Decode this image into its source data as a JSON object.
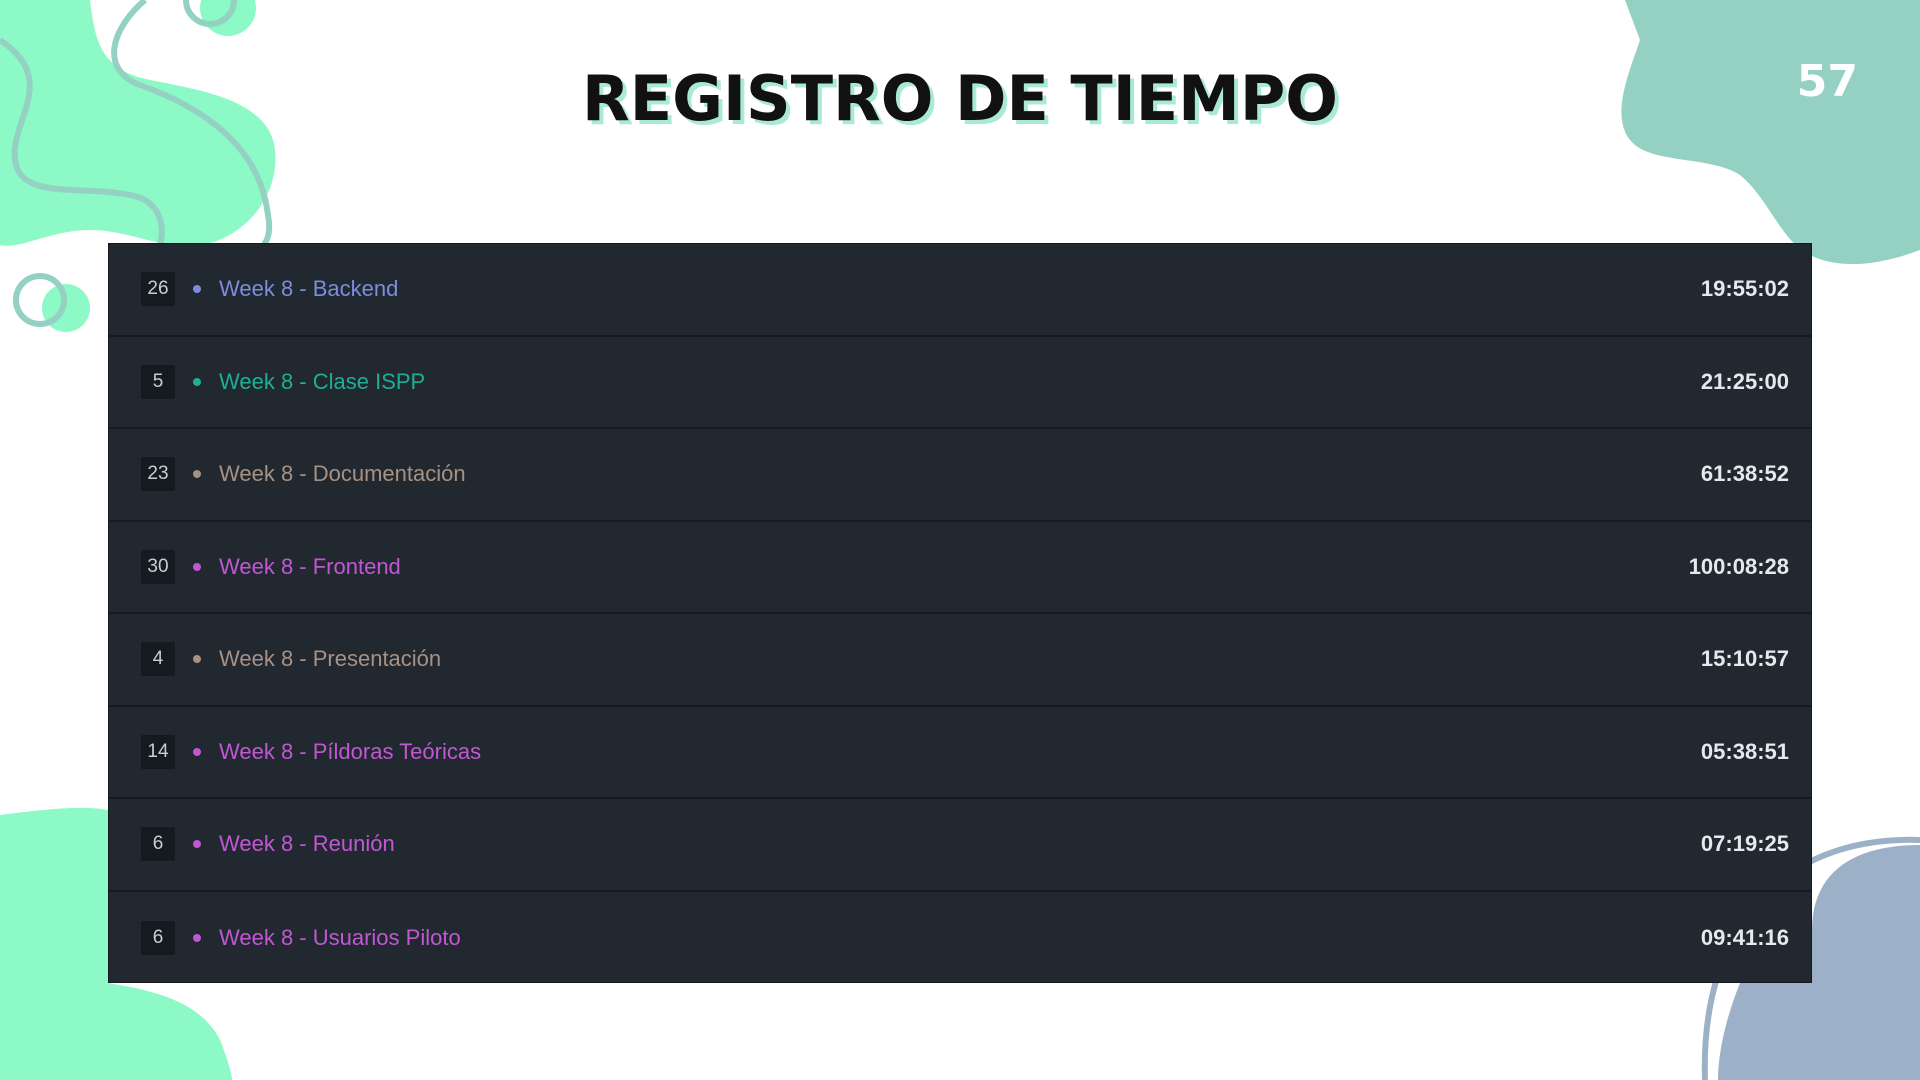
{
  "slide": {
    "title": "REGISTRO DE TIEMPO",
    "page_number": "57"
  },
  "colors": {
    "mint": "#8cf9c6",
    "teal": "#94d1c3",
    "slate_blue": "#9cb1c8",
    "panel_bg": "#212830",
    "title_shadow": "#a8ead2"
  },
  "entries": [
    {
      "count": "26",
      "name": "Week 8 - Backend",
      "time": "19:55:02",
      "color": "#7c8ddc"
    },
    {
      "count": "5",
      "name": "Week 8 - Clase ISPP",
      "time": "21:25:00",
      "color": "#1fae94"
    },
    {
      "count": "23",
      "name": "Week 8 - Documentación",
      "time": "61:38:52",
      "color": "#a79183"
    },
    {
      "count": "30",
      "name": "Week 8 - Frontend",
      "time": "100:08:28",
      "color": "#c257d4"
    },
    {
      "count": "4",
      "name": "Week 8 - Presentación",
      "time": "15:10:57",
      "color": "#a79183"
    },
    {
      "count": "14",
      "name": "Week 8 - Píldoras Teóricas",
      "time": "05:38:51",
      "color": "#c257d4"
    },
    {
      "count": "6",
      "name": "Week 8 - Reunión",
      "time": "07:19:25",
      "color": "#c257d4"
    },
    {
      "count": "6",
      "name": "Week 8 - Usuarios Piloto",
      "time": "09:41:16",
      "color": "#c257d4"
    }
  ]
}
